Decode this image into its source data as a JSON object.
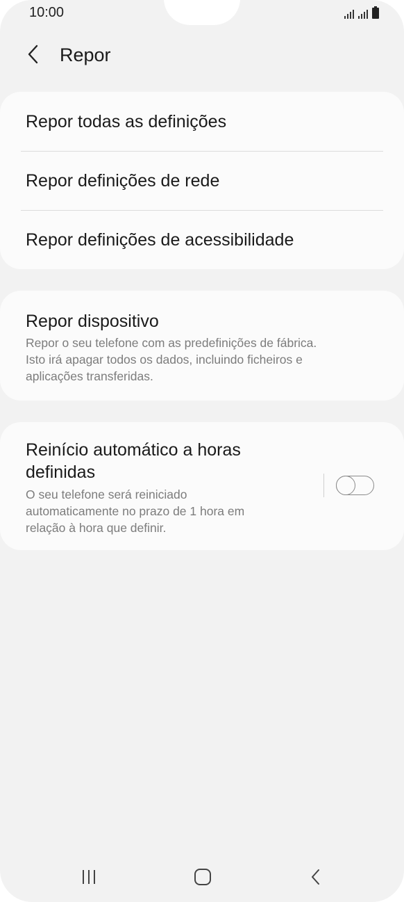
{
  "status_bar": {
    "time": "10:00"
  },
  "header": {
    "title": "Repor",
    "back_icon": "chevron-left-icon"
  },
  "reset_options": [
    {
      "label": "Repor todas as definições"
    },
    {
      "label": "Repor definições de rede"
    },
    {
      "label": "Repor definições de acessibilidade"
    }
  ],
  "factory_reset": {
    "title": "Repor dispositivo",
    "description_lines": [
      "Repor o seu telefone com as predefinições de fábrica.",
      "Isto irá apagar todos os dados, incluindo ficheiros e",
      "aplicações transferidas."
    ]
  },
  "auto_restart": {
    "title_lines": [
      "Reinício automático a horas",
      "definidas"
    ],
    "description_lines": [
      "O seu telefone será reiniciado",
      "automaticamente no prazo de 1 hora em",
      "relação à hora que definir."
    ],
    "enabled": false
  },
  "nav_bar": {
    "recents_icon": "recent-apps-icon",
    "home_icon": "home-icon",
    "back_icon": "back-icon"
  },
  "colors": {
    "background": "#f2f2f2",
    "card": "#fbfbfb",
    "secondary_text": "#7c7c7c"
  }
}
